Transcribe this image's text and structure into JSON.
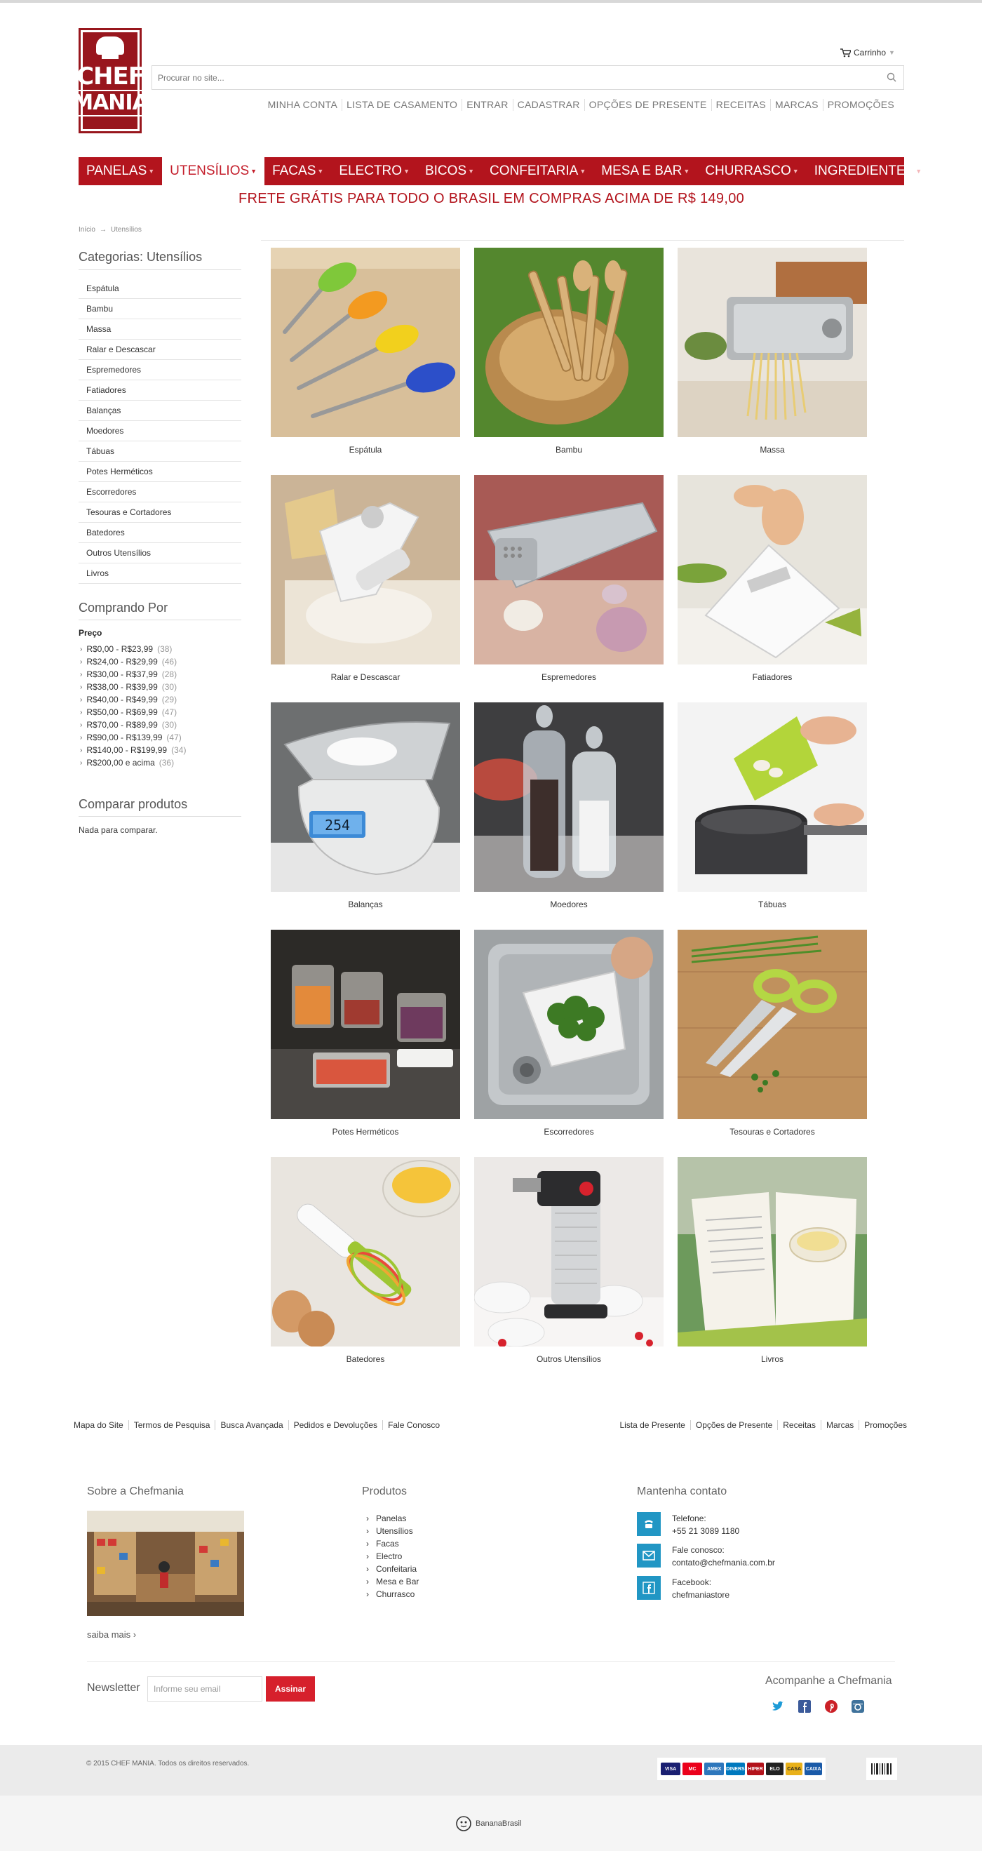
{
  "header": {
    "logo_line1": "CHEF",
    "logo_line2": "MANIA",
    "cart_label": "Carrinho",
    "search_placeholder": "Procurar no site...",
    "top_links": [
      "MINHA CONTA",
      "LISTA DE CASAMENTO",
      "ENTRAR",
      "CADASTRAR",
      "OPÇÕES DE PRESENTE",
      "RECEITAS",
      "MARCAS",
      "PROMOÇÕES"
    ]
  },
  "nav": {
    "items": [
      "PANELAS",
      "UTENSÍLIOS",
      "FACAS",
      "ELECTRO",
      "BICOS",
      "CONFEITARIA",
      "MESA E BAR",
      "CHURRASCO",
      "INGREDIENTES"
    ],
    "active": "UTENSÍLIOS"
  },
  "promo_text": "FRETE GRÁTIS PARA TODO O BRASIL EM COMPRAS ACIMA DE R$ 149,00",
  "breadcrumb": {
    "home": "Início",
    "current": "Utensílios"
  },
  "sidebar": {
    "categories_title": "Categorias: Utensílios",
    "categories": [
      "Espátula",
      "Bambu",
      "Massa",
      "Ralar e Descascar",
      "Espremedores",
      "Fatiadores",
      "Balanças",
      "Moedores",
      "Tábuas",
      "Potes Herméticos",
      "Escorredores",
      "Tesouras e Cortadores",
      "Batedores",
      "Outros Utensílios",
      "Livros"
    ],
    "shopping_by_title": "Comprando Por",
    "price_label": "Preço",
    "price_ranges": [
      {
        "label": "R$0,00 - R$23,99",
        "count": "(38)"
      },
      {
        "label": "R$24,00 - R$29,99",
        "count": "(46)"
      },
      {
        "label": "R$30,00 - R$37,99",
        "count": "(28)"
      },
      {
        "label": "R$38,00 - R$39,99",
        "count": "(30)"
      },
      {
        "label": "R$40,00 - R$49,99",
        "count": "(29)"
      },
      {
        "label": "R$50,00 - R$69,99",
        "count": "(47)"
      },
      {
        "label": "R$70,00 - R$89,99",
        "count": "(30)"
      },
      {
        "label": "R$90,00 - R$139,99",
        "count": "(47)"
      },
      {
        "label": "R$140,00 - R$199,99",
        "count": "(34)"
      },
      {
        "label": "R$200,00 e acima",
        "count": "(36)"
      }
    ],
    "compare_title": "Comparar produtos",
    "compare_text": "Nada para comparar."
  },
  "grid": {
    "items": [
      "Espátula",
      "Bambu",
      "Massa",
      "Ralar e Descascar",
      "Espremedores",
      "Fatiadores",
      "Balanças",
      "Moedores",
      "Tábuas",
      "Potes Herméticos",
      "Escorredores",
      "Tesouras e Cortadores",
      "Batedores",
      "Outros Utensílios",
      "Livros"
    ],
    "scale_display": "254"
  },
  "footer": {
    "links_left": [
      "Mapa do Site",
      "Termos de Pesquisa",
      "Busca Avançada",
      "Pedidos e Devoluções",
      "Fale Conosco"
    ],
    "links_right": [
      "Lista de Presente",
      "Opções de Presente",
      "Receitas",
      "Marcas",
      "Promoções"
    ],
    "about_title": "Sobre a Chefmania",
    "about_more": "saiba mais",
    "products_title": "Produtos",
    "products": [
      "Panelas",
      "Utensílios",
      "Facas",
      "Electro",
      "Confeitaria",
      "Mesa e Bar",
      "Churrasco"
    ],
    "contact_title": "Mantenha contato",
    "contacts": [
      {
        "label": "Telefone:",
        "value": "+55 21 3089 1180",
        "icon": "phone-icon"
      },
      {
        "label": "Fale conosco:",
        "value": "contato@chefmania.com.br",
        "icon": "mail-icon"
      },
      {
        "label": "Facebook:",
        "value": "chefmaniastore",
        "icon": "facebook-icon"
      }
    ],
    "newsletter_label": "Newsletter",
    "newsletter_placeholder": "Informe seu email",
    "newsletter_button": "Assinar",
    "follow_title": "Acompanhe a Chefmania",
    "copyright": "© 2015 CHEF MANIA. Todos os direitos reservados.",
    "payment_cards": [
      "VISA",
      "MC",
      "AMEX",
      "DINERS",
      "HIPER",
      "ELO",
      "CASA",
      "CAIXA"
    ],
    "developer": "BananaBrasil"
  },
  "colors": {
    "brand_red": "#b3141d",
    "accent_blue": "#2196c4",
    "button_red": "#d6202c"
  }
}
